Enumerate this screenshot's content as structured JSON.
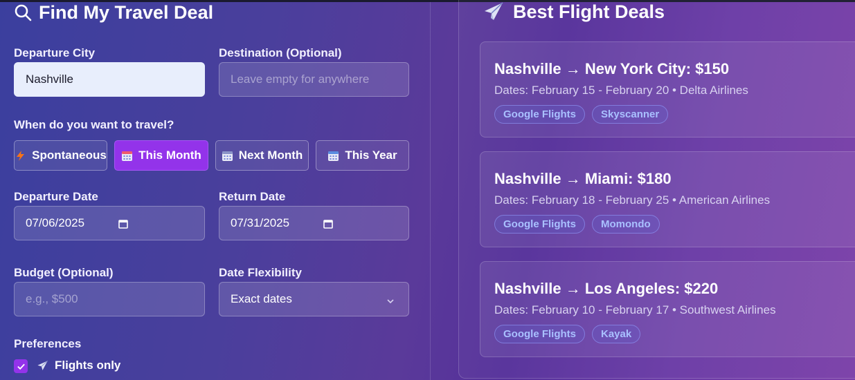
{
  "search_form": {
    "title": "Find My Travel Deal",
    "departure_city": {
      "label": "Departure City",
      "value": "Nashville"
    },
    "destination": {
      "label": "Destination (Optional)",
      "placeholder": "Leave empty for anywhere",
      "value": ""
    },
    "when_label": "When do you want to travel?",
    "time_options": [
      {
        "label": "Spontaneous",
        "icon": "lightning-icon",
        "selected": false
      },
      {
        "label": "This Month",
        "icon": "calendar-icon",
        "selected": true
      },
      {
        "label": "Next Month",
        "icon": "calendar-icon",
        "selected": false
      },
      {
        "label": "This Year",
        "icon": "calendar-icon",
        "selected": false
      }
    ],
    "departure_date": {
      "label": "Departure Date",
      "value": "2025-07-06"
    },
    "return_date": {
      "label": "Return Date",
      "value": "2025-07-31"
    },
    "budget": {
      "label": "Budget (Optional)",
      "placeholder": "e.g., $500",
      "value": ""
    },
    "flexibility": {
      "label": "Date Flexibility",
      "value": "Exact dates",
      "options": [
        "Exact dates"
      ]
    },
    "preferences": {
      "label": "Preferences",
      "flights_only": {
        "label": "Flights only",
        "checked": true,
        "icon": "airplane-icon"
      }
    }
  },
  "results": {
    "title": "Best Flight Deals",
    "icon": "airplane-icon",
    "deals": [
      {
        "route": "Nashville → New York City: $150",
        "meta": "Dates: February 15 - February 20 • Delta Airlines",
        "sources": [
          "Google Flights",
          "Skyscanner"
        ]
      },
      {
        "route": "Nashville → Miami: $180",
        "meta": "Dates: February 18 - February 25 • American Airlines",
        "sources": [
          "Google Flights",
          "Momondo"
        ]
      },
      {
        "route": "Nashville → Los Angeles: $220",
        "meta": "Dates: February 10 - February 17 • Southwest Airlines",
        "sources": [
          "Google Flights",
          "Kayak"
        ]
      }
    ]
  },
  "colors": {
    "accent": "#9333ea",
    "tag_text": "#a9c0ff"
  }
}
